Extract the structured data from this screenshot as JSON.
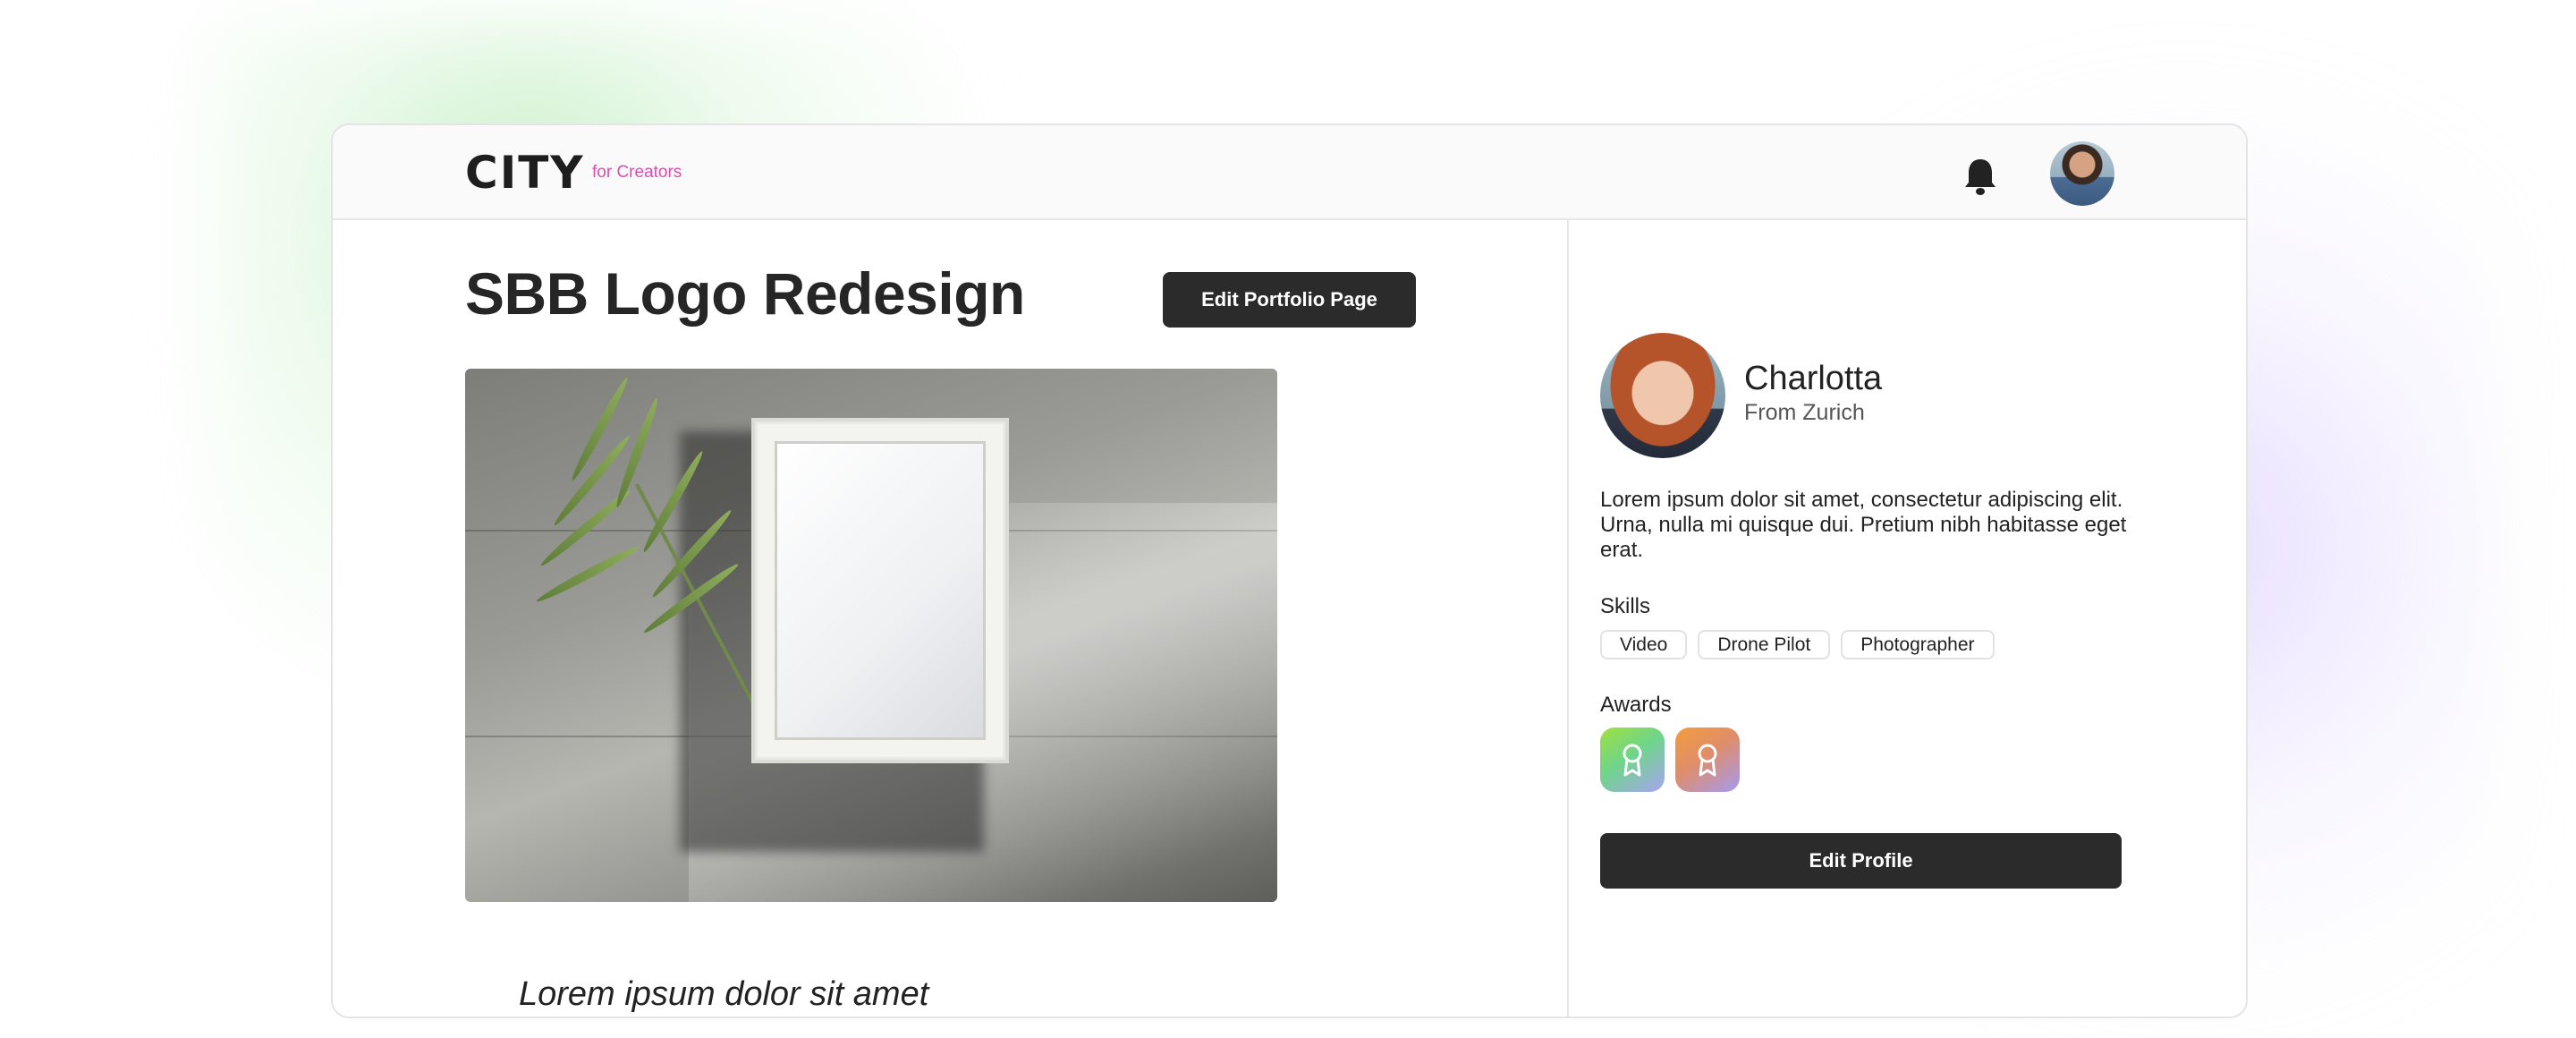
{
  "brand": {
    "logo": "CITY",
    "sub": "for Creators"
  },
  "header": {
    "notification_icon": "bell-icon",
    "avatar": "user-avatar"
  },
  "portfolio": {
    "title": "SBB Logo Redesign",
    "edit_button": "Edit Portfolio Page",
    "caption": "Lorem ipsum dolor sit amet"
  },
  "profile": {
    "name": "Charlotta",
    "from": "From Zurich",
    "bio": "Lorem ipsum dolor sit amet, consectetur adipiscing elit. Urna, nulla mi quisque dui. Pretium nibh habitasse eget erat.",
    "skills_label": "Skills",
    "skills": [
      "Video",
      "Drone Pilot",
      "Photographer"
    ],
    "awards_label": "Awards",
    "awards": [
      "award-ribbon-icon",
      "award-ribbon-icon"
    ],
    "edit_button": "Edit Profile"
  },
  "colors": {
    "accent_pink": "#d94fae",
    "button_dark": "#2b2b2b"
  }
}
